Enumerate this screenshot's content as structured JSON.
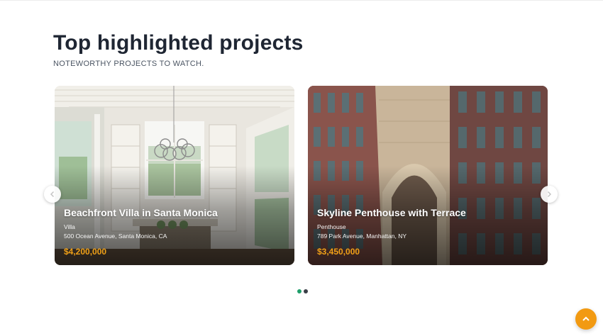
{
  "section": {
    "title": "Top highlighted projects",
    "subtitle": "NOTEWORTHY PROJECTS TO WATCH."
  },
  "projects": [
    {
      "name": "Beachfront Villa in Santa Monica",
      "type": "Villa",
      "address": "500 Ocean Avenue, Santa Monica, CA",
      "price": "$4,200,000",
      "image_subject": "bright dining nook with glass pendant chandelier and windows"
    },
    {
      "name": "Skyline Penthouse with Terrace",
      "type": "Penthouse",
      "address": "789 Park Avenue, Manhattan, NY",
      "price": "$3,450,000",
      "image_subject": "brick high-rise facade with stone archway"
    }
  ],
  "carousel": {
    "prev_icon": "chevron-left-icon",
    "next_icon": "chevron-right-icon",
    "pages": 2,
    "active_page": 1
  },
  "colors": {
    "title": "#1f2633",
    "price": "#f0a017",
    "dot_active": "#1f9e6a",
    "dot_inactive": "#3a3f47",
    "back_to_top": "#f29a12"
  },
  "back_to_top_icon": "chevron-up-icon"
}
